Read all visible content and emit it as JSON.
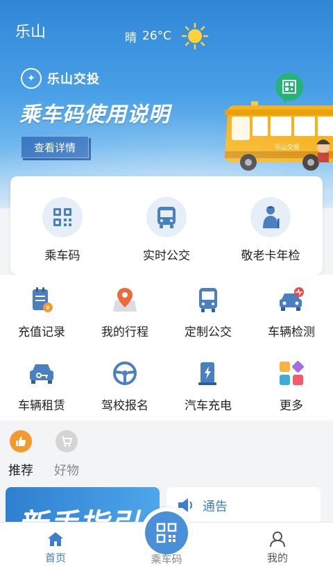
{
  "header": {
    "city": "乐山",
    "weather_text": "晴",
    "temperature": "26°C",
    "weather_icon": "sun-icon"
  },
  "banner": {
    "brand_name": "乐山交投",
    "title": "乘车码使用说明",
    "button_label": "查看详情",
    "bus_logo_text": "乐山交投"
  },
  "quick_actions": [
    {
      "label": "乘车码",
      "icon": "qr-code-icon"
    },
    {
      "label": "实时公交",
      "icon": "bus-icon"
    },
    {
      "label": "敬老卡年检",
      "icon": "elderly-icon"
    }
  ],
  "services": [
    {
      "label": "充值记录",
      "icon": "recharge-record-icon"
    },
    {
      "label": "我的行程",
      "icon": "location-pin-icon"
    },
    {
      "label": "定制公交",
      "icon": "bus-icon"
    },
    {
      "label": "车辆检测",
      "icon": "car-inspection-icon"
    },
    {
      "label": "车辆租赁",
      "icon": "car-rental-icon"
    },
    {
      "label": "驾校报名",
      "icon": "steering-wheel-icon"
    },
    {
      "label": "汽车充电",
      "icon": "charging-station-icon"
    },
    {
      "label": "更多",
      "icon": "more-apps-icon"
    }
  ],
  "tabs": [
    {
      "label": "推荐",
      "active": true
    },
    {
      "label": "好物",
      "active": false
    }
  ],
  "guide_card": {
    "text": "新手指引"
  },
  "notice_card": {
    "label": "通告"
  },
  "bottom_nav": {
    "home": "首页",
    "ride_code": "乘车码",
    "mine": "我的"
  },
  "colors": {
    "primary": "#3b7ed0",
    "orange": "#f39a2e",
    "bus_yellow": "#f6b21b"
  }
}
